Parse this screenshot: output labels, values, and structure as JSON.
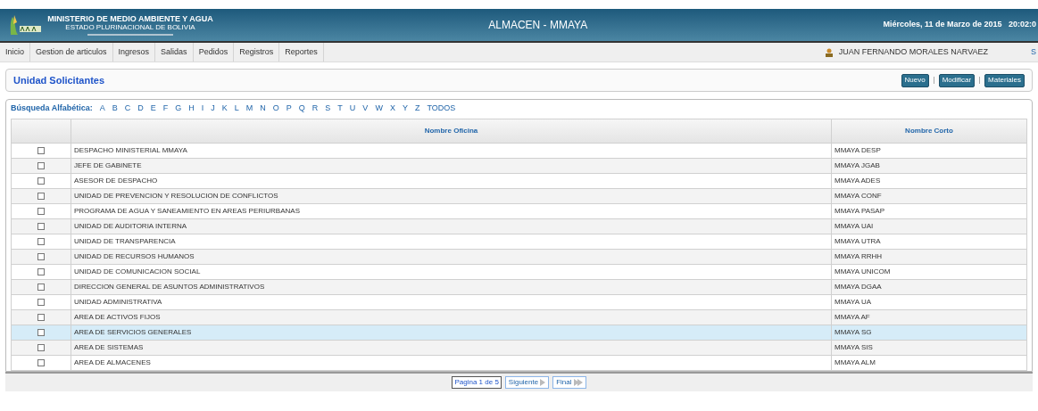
{
  "header": {
    "ministry": "MINISTERIO DE MEDIO AMBIENTE Y AGUA",
    "state": "ESTADO PLURINACIONAL DE BOLIVIA",
    "app_title": "ALMACEN - MMAYA",
    "datetime": "Miércoles, 11 de Marzo de 2015   20:02:0"
  },
  "menu": [
    "Inicio",
    "Gestion de articulos",
    "Ingresos",
    "Salidas",
    "Pedidos",
    "Registros",
    "Reportes"
  ],
  "user": "JUAN FERNANDO MORALES NARVAEZ",
  "logout_fragment": "S",
  "page_title": "Unidad Solicitantes",
  "actions": [
    "Nuevo",
    "Modificar",
    "Materiales"
  ],
  "alpha_search": {
    "label": "Búsqueda Alfabética:",
    "letters": [
      "A",
      "B",
      "C",
      "D",
      "E",
      "F",
      "G",
      "H",
      "I",
      "J",
      "K",
      "L",
      "M",
      "N",
      "O",
      "P",
      "Q",
      "R",
      "S",
      "T",
      "U",
      "V",
      "W",
      "X",
      "Y",
      "Z",
      "TODOS"
    ]
  },
  "table": {
    "columns": [
      "Nombre Oficina",
      "Nombre Corto"
    ],
    "rows": [
      {
        "name": "DESPACHO MINISTERIAL MMAYA",
        "short": "MMAYA DESP",
        "checked": false,
        "selected": false
      },
      {
        "name": "JEFE DE GABINETE",
        "short": "MMAYA JGAB",
        "checked": false,
        "selected": false
      },
      {
        "name": "ASESOR DE DESPACHO",
        "short": "MMAYA ADES",
        "checked": false,
        "selected": false
      },
      {
        "name": "UNIDAD DE PREVENCION Y RESOLUCION DE CONFLICTOS",
        "short": "MMAYA CONF",
        "checked": false,
        "selected": false
      },
      {
        "name": "PROGRAMA DE AGUA Y SANEAMIENTO EN AREAS PERIURBANAS",
        "short": "MMAYA PASAP",
        "checked": false,
        "selected": false
      },
      {
        "name": "UNIDAD DE AUDITORIA INTERNA",
        "short": "MMAYA UAI",
        "checked": false,
        "selected": false
      },
      {
        "name": "UNIDAD DE TRANSPARENCIA",
        "short": "MMAYA UTRA",
        "checked": false,
        "selected": false
      },
      {
        "name": "UNIDAD DE RECURSOS HUMANOS",
        "short": "MMAYA RRHH",
        "checked": false,
        "selected": false
      },
      {
        "name": "UNIDAD DE COMUNICACION SOCIAL",
        "short": "MMAYA UNICOM",
        "checked": false,
        "selected": false
      },
      {
        "name": "DIRECCION GENERAL DE ASUNTOS ADMINISTRATIVOS",
        "short": "MMAYA DGAA",
        "checked": false,
        "selected": false
      },
      {
        "name": "UNIDAD ADMINISTRATIVA",
        "short": "MMAYA UA",
        "checked": false,
        "selected": false
      },
      {
        "name": "AREA DE ACTIVOS FIJOS",
        "short": "MMAYA AF",
        "checked": false,
        "selected": false
      },
      {
        "name": "AREA DE SERVICIOS GENERALES",
        "short": "MMAYA SG",
        "checked": false,
        "selected": true
      },
      {
        "name": "AREA DE SISTEMAS",
        "short": "MMAYA SIS",
        "checked": false,
        "selected": false
      },
      {
        "name": "AREA DE ALMACENES",
        "short": "MMAYA ALM",
        "checked": false,
        "selected": false
      }
    ]
  },
  "pagination": {
    "page": "Pagina 1 de 5",
    "next": "Siguiente",
    "last": "Final"
  }
}
